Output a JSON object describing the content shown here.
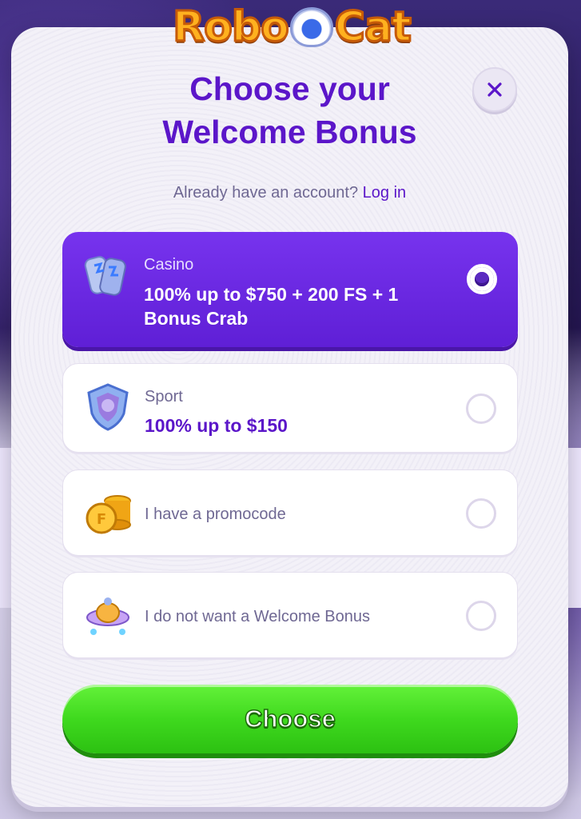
{
  "brand": {
    "logo_text_left": "Robo",
    "logo_text_right": "Cat"
  },
  "modal": {
    "title_line1": "Choose your",
    "title_line2": "Welcome Bonus",
    "login_prompt": "Already have an account?",
    "login_link": "Log in",
    "close_icon": "close-icon"
  },
  "options": [
    {
      "label": "Casino",
      "value_line1": "100% up to $750 + 200 FS + 1",
      "value_line2": "Bonus Crab",
      "icon": "casino-tickets-icon",
      "selected": true
    },
    {
      "label": "Sport",
      "value_line1": "100% up to $150",
      "icon": "sport-shield-icon",
      "selected": false
    },
    {
      "label": "I have a promocode",
      "icon": "coins-icon",
      "selected": false
    },
    {
      "label": "I do not want a Welcome Bonus",
      "icon": "robot-spaceship-icon",
      "selected": false
    }
  ],
  "choose_button": {
    "label": "Choose"
  },
  "colors": {
    "accent": "#5b16c9",
    "selected_bg": "#6f2be6",
    "button_green": "#3fd91e"
  }
}
